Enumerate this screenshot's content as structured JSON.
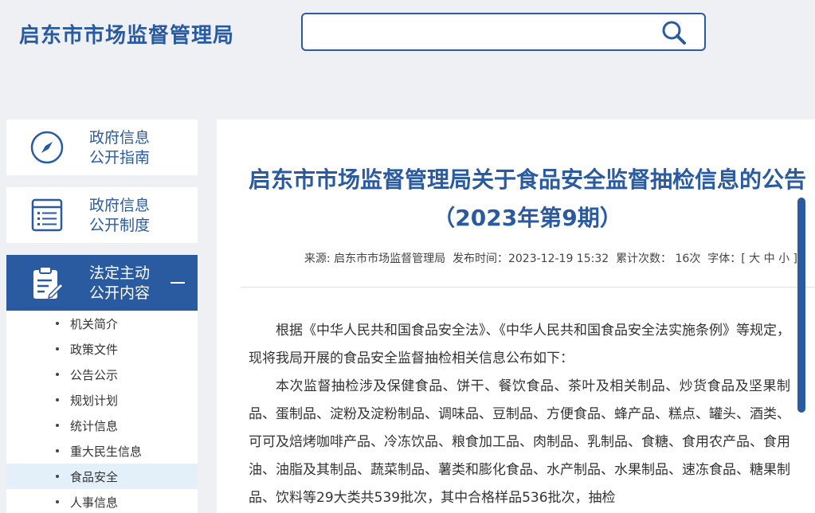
{
  "header": {
    "site_title": "启东市市场监督管理局",
    "search": {
      "value": "",
      "placeholder": ""
    }
  },
  "sidebar": {
    "cards": [
      {
        "label_line1": "政府信息",
        "label_line2": "公开指南",
        "icon": "compass-icon"
      },
      {
        "label_line1": "政府信息",
        "label_line2": "公开制度",
        "icon": "list-doc-icon"
      },
      {
        "label_line1": "法定主动",
        "label_line2": "公开内容",
        "icon": "clipboard-edit-icon",
        "expanded": true
      }
    ],
    "sub_items": [
      {
        "label": "机关简介"
      },
      {
        "label": "政策文件"
      },
      {
        "label": "公告公示"
      },
      {
        "label": "规划计划"
      },
      {
        "label": "统计信息"
      },
      {
        "label": "重大民生信息"
      },
      {
        "label": "食品安全",
        "selected": true
      },
      {
        "label": "人事信息"
      }
    ]
  },
  "article": {
    "title": "启东市市场监督管理局关于食品安全监督抽检信息的公告（2023年第9期）",
    "meta": {
      "source_label": "来源:",
      "source": "启东市市场监督管理局",
      "date_label": "发布时间：",
      "date": "2023-12-19 15:32",
      "views_label": "累计次数：",
      "views": "16次",
      "font_label": "字体：[",
      "font_large": "大",
      "font_medium": "中",
      "font_small": "小",
      "font_close": "]"
    },
    "paragraphs": [
      "根据《中华人民共和国食品安全法》、《中华人民共和国食品安全法实施条例》等规定，现将我局开展的食品安全监督抽检相关信息公布如下：",
      "本次监督抽检涉及保健食品、饼干、餐饮食品、茶叶及相关制品、炒货食品及坚果制品、蛋制品、淀粉及淀粉制品、调味品、豆制品、方便食品、蜂产品、糕点、罐头、酒类、可可及焙烤咖啡产品、冷冻饮品、粮食加工品、肉制品、乳制品、食糖、食用农产品、食用油、油脂及其制品、蔬菜制品、薯类和膨化食品、水产制品、水果制品、速冻食品、糖果制品、饮料等29大类共539批次，其中合格样品536批次，抽检"
    ]
  },
  "colors": {
    "brand": "#2a5aa0",
    "selected_bg": "#e3f0fa"
  }
}
